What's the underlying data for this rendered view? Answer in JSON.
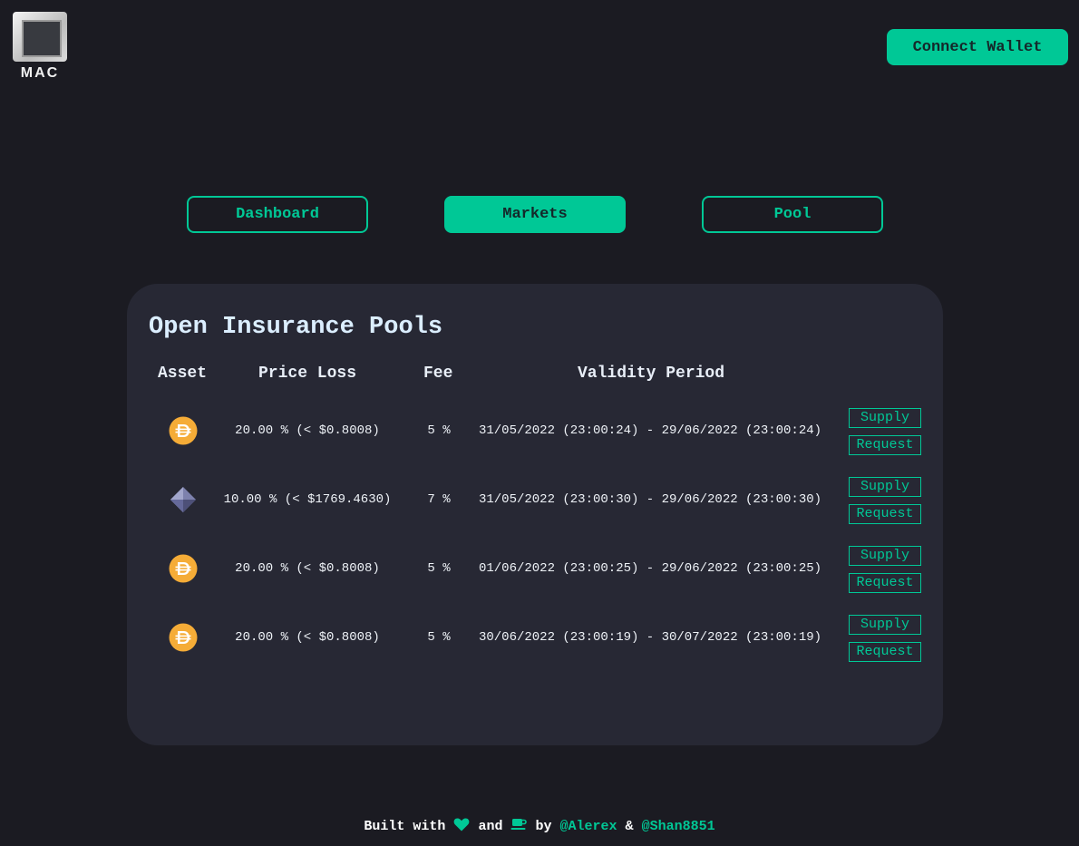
{
  "header": {
    "logo_text": "MAC",
    "connect_wallet_label": "Connect Wallet"
  },
  "nav": {
    "tabs": [
      {
        "label": "Dashboard",
        "active": false
      },
      {
        "label": "Markets",
        "active": true
      },
      {
        "label": "Pool",
        "active": false
      }
    ]
  },
  "pools": {
    "title": "Open Insurance Pools",
    "columns": [
      "Asset",
      "Price Loss",
      "Fee",
      "Validity Period"
    ],
    "rows": [
      {
        "asset_icon": "dai-icon",
        "price_loss": "20.00 % (< $0.8008)",
        "fee": "5 %",
        "validity": "31/05/2022 (23:00:24) - 29/06/2022 (23:00:24)",
        "supply_label": "Supply",
        "request_label": "Request"
      },
      {
        "asset_icon": "eth-icon",
        "price_loss": "10.00 % (< $1769.4630)",
        "fee": "7 %",
        "validity": "31/05/2022 (23:00:30) - 29/06/2022 (23:00:30)",
        "supply_label": "Supply",
        "request_label": "Request"
      },
      {
        "asset_icon": "dai-icon",
        "price_loss": "20.00 % (< $0.8008)",
        "fee": "5 %",
        "validity": "01/06/2022 (23:00:25) - 29/06/2022 (23:00:25)",
        "supply_label": "Supply",
        "request_label": "Request"
      },
      {
        "asset_icon": "dai-icon",
        "price_loss": "20.00 % (< $0.8008)",
        "fee": "5 %",
        "validity": "30/06/2022 (23:00:19) - 30/07/2022 (23:00:19)",
        "supply_label": "Supply",
        "request_label": "Request"
      }
    ]
  },
  "footer": {
    "built_with": "Built with",
    "and": "and",
    "by": "by",
    "author1": "@Alerex",
    "amp": "&",
    "author2": "@Shan8851"
  },
  "colors": {
    "accent": "#00c896",
    "background": "#1b1b22",
    "card": "#272834",
    "dai": "#f5ac37",
    "eth": "#6b6f9e"
  }
}
